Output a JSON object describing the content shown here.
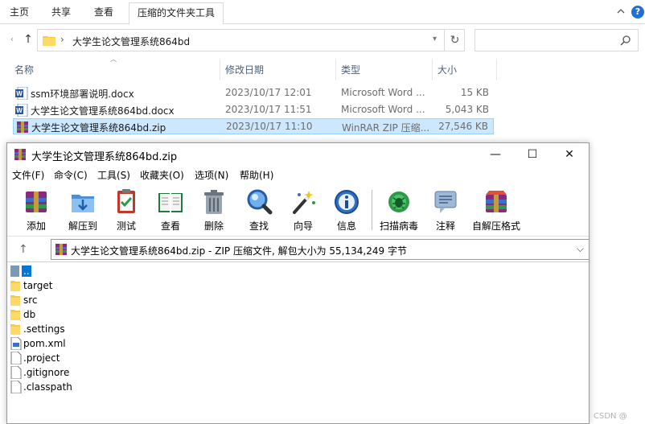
{
  "explorer": {
    "ribbon_tabs": [
      "主页",
      "共享",
      "查看",
      "压缩的文件夹工具"
    ],
    "help_label": "?",
    "address_path": "大学生论文管理系统864bd",
    "columns": {
      "name": "名称",
      "date": "修改日期",
      "type": "类型",
      "size": "大小"
    },
    "files": [
      {
        "name": "ssm环境部署说明.docx",
        "date": "2023/10/17 12:01",
        "type": "Microsoft Word ...",
        "size": "15 KB",
        "icon": "word-doc-icon"
      },
      {
        "name": "大学生论文管理系统864bd.docx",
        "date": "2023/10/17 11:51",
        "type": "Microsoft Word ...",
        "size": "5,043 KB",
        "icon": "word-doc-icon"
      },
      {
        "name": "大学生论文管理系统864bd.zip",
        "date": "2023/10/17 11:10",
        "type": "WinRAR ZIP 压缩...",
        "size": "27,546 KB",
        "icon": "winrar-archive-icon",
        "selected": true
      }
    ]
  },
  "winrar": {
    "title": "大学生论文管理系统864bd.zip",
    "menu": [
      "文件(F)",
      "命令(C)",
      "工具(S)",
      "收藏夹(O)",
      "选项(N)",
      "帮助(H)"
    ],
    "toolbar": [
      {
        "label": "添加",
        "icon": "add-archive-icon"
      },
      {
        "label": "解压到",
        "icon": "extract-to-icon"
      },
      {
        "label": "测试",
        "icon": "test-icon"
      },
      {
        "label": "查看",
        "icon": "view-book-icon"
      },
      {
        "label": "删除",
        "icon": "delete-trash-icon"
      },
      {
        "label": "查找",
        "icon": "find-magnifier-icon"
      },
      {
        "label": "向导",
        "icon": "wizard-wand-icon"
      },
      {
        "label": "信息",
        "icon": "info-icon"
      },
      {
        "label": "扫描病毒",
        "icon": "virus-scan-icon"
      },
      {
        "label": "注释",
        "icon": "comment-icon"
      },
      {
        "label": "自解压格式",
        "icon": "sfx-icon"
      }
    ],
    "path_text": "大学生论文管理系统864bd.zip - ZIP 压缩文件, 解包大小为 55,134,249 字节",
    "entries": [
      {
        "name": "..",
        "kind": "parent"
      },
      {
        "name": "target",
        "kind": "folder"
      },
      {
        "name": "src",
        "kind": "folder"
      },
      {
        "name": "db",
        "kind": "folder"
      },
      {
        "name": ".settings",
        "kind": "folder"
      },
      {
        "name": "pom.xml",
        "kind": "xml"
      },
      {
        "name": ".project",
        "kind": "file"
      },
      {
        "name": ".gitignore",
        "kind": "file"
      },
      {
        "name": ".classpath",
        "kind": "file"
      }
    ]
  },
  "watermark": "CSDN @"
}
